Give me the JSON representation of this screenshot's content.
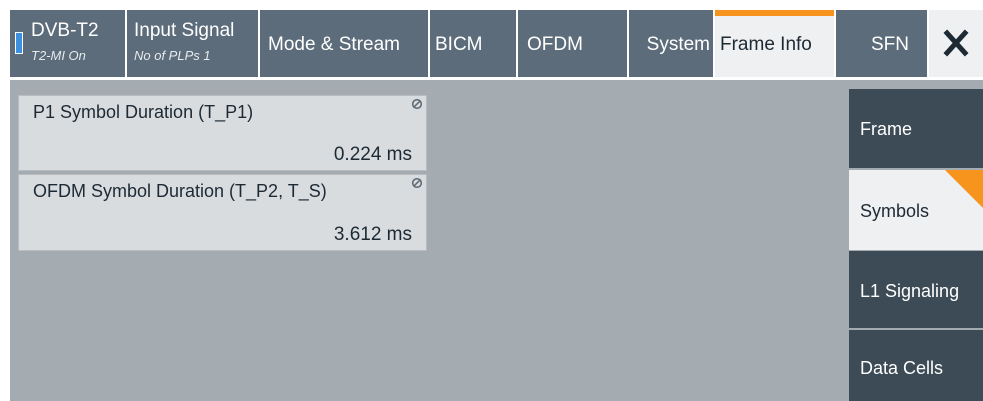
{
  "tabs": [
    {
      "key": "dvb",
      "label": "DVB-T2",
      "sub": "T2-MI On"
    },
    {
      "key": "input",
      "label": "Input Signal",
      "sub": "No of PLPs 1"
    },
    {
      "key": "mode",
      "label": "Mode & Stream"
    },
    {
      "key": "bicm",
      "label": "BICM"
    },
    {
      "key": "ofdm",
      "label": "OFDM"
    },
    {
      "key": "system",
      "label": "System"
    },
    {
      "key": "frameinfo",
      "label": "Frame Info",
      "active": true
    },
    {
      "key": "sfn",
      "label": "SFN"
    }
  ],
  "close_icon": "close-icon",
  "fields": [
    {
      "label": "P1 Symbol Duration (T_P1)",
      "value": "0.224 ms",
      "icon": "read-only-icon"
    },
    {
      "label": "OFDM Symbol Duration (T_P2, T_S)",
      "value": "3.612 ms",
      "icon": "read-only-icon"
    }
  ],
  "side_nav": [
    {
      "label": "Frame",
      "selected": false
    },
    {
      "label": "Symbols",
      "selected": true
    },
    {
      "label": "L1 Signaling",
      "selected": false
    },
    {
      "label": "Data Cells",
      "selected": false
    }
  ],
  "colors": {
    "accent": "#f7941d",
    "tab_bg": "#5c6c7a",
    "content_bg": "#a4abb1",
    "side_dark": "#3c4b55"
  }
}
